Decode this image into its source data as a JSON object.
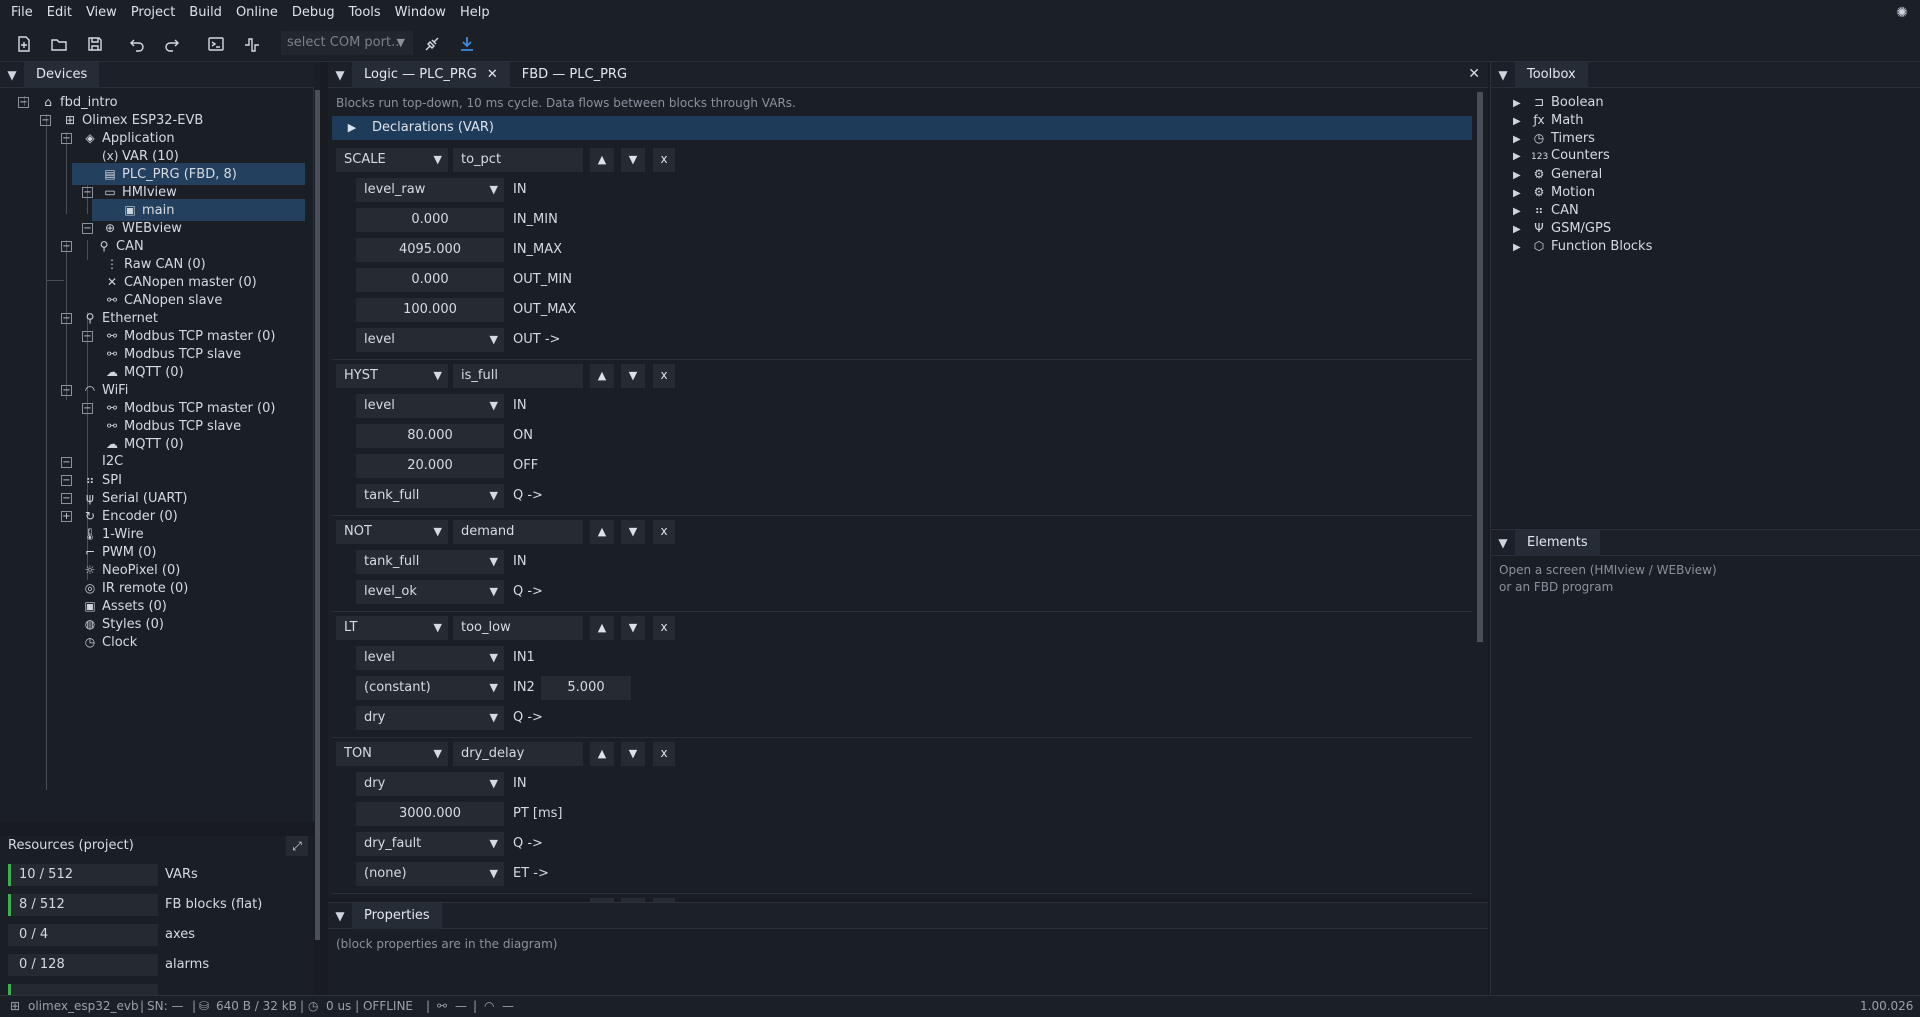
{
  "menu": [
    "File",
    "Edit",
    "View",
    "Project",
    "Build",
    "Online",
    "Debug",
    "Tools",
    "Window",
    "Help"
  ],
  "toolbar": {
    "com_port_placeholder": "select COM port..",
    "icons": [
      "new-file-icon",
      "open-folder-icon",
      "save-icon",
      "undo-icon",
      "redo-icon",
      "terminal-icon",
      "step-icon",
      "connect-icon",
      "download-icon"
    ]
  },
  "devices": {
    "tab": "Devices",
    "tree": [
      {
        "label": "fbd_intro",
        "icon": "project-icon"
      },
      {
        "label": "Olimex ESP32-EVB",
        "icon": "chip-icon"
      },
      {
        "label": "Application",
        "icon": "layers-icon"
      },
      {
        "label": "VAR (10)",
        "icon": "variable-icon"
      },
      {
        "label": "PLC_PRG (FBD, 8)",
        "icon": "file-icon"
      },
      {
        "label": "HMIview",
        "icon": "monitor-icon"
      },
      {
        "label": "main",
        "icon": "image-icon"
      },
      {
        "label": "WEBview",
        "icon": "globe-icon"
      },
      {
        "label": "CAN",
        "icon": "network-icon"
      },
      {
        "label": "Raw CAN (0)",
        "icon": "raw-can-icon"
      },
      {
        "label": "CANopen master (0)",
        "icon": "canopen-icon"
      },
      {
        "label": "CANopen slave",
        "icon": "plug-icon"
      },
      {
        "label": "Ethernet",
        "icon": "network-icon"
      },
      {
        "label": "Modbus TCP master (0)",
        "icon": "plug-icon"
      },
      {
        "label": "Modbus TCP slave",
        "icon": "plug-icon"
      },
      {
        "label": "MQTT (0)",
        "icon": "cloud-icon"
      },
      {
        "label": "WiFi",
        "icon": "wifi-icon"
      },
      {
        "label": "Modbus TCP master (0)",
        "icon": "plug-icon"
      },
      {
        "label": "Modbus TCP slave",
        "icon": "plug-icon"
      },
      {
        "label": "MQTT (0)",
        "icon": "cloud-icon"
      },
      {
        "label": "I2C",
        "icon": "none"
      },
      {
        "label": "SPI",
        "icon": "spi-icon"
      },
      {
        "label": "Serial (UART)",
        "icon": "usb-icon"
      },
      {
        "label": "Encoder (0)",
        "icon": "encoder-icon"
      },
      {
        "label": "1-Wire",
        "icon": "thermometer-icon"
      },
      {
        "label": "PWM (0)",
        "icon": "pwm-icon"
      },
      {
        "label": "NeoPixel (0)",
        "icon": "light-icon"
      },
      {
        "label": "IR remote (0)",
        "icon": "ir-icon"
      },
      {
        "label": "Assets (0)",
        "icon": "image-icon"
      },
      {
        "label": "Styles (0)",
        "icon": "palette-icon"
      },
      {
        "label": "Clock",
        "icon": "clock-icon"
      }
    ]
  },
  "resources": {
    "title": "Resources (project)",
    "rows": [
      {
        "value": "10 / 512",
        "label": "VARs",
        "level": 0.02
      },
      {
        "value": "8 / 512",
        "label": "FB blocks (flat)",
        "level": 0.016
      },
      {
        "value": "0 / 4",
        "label": "axes",
        "level": 0
      },
      {
        "value": "0 / 128",
        "label": "alarms",
        "level": 0
      }
    ]
  },
  "logic": {
    "tabs": [
      "Logic — PLC_PRG",
      "FBD — PLC_PRG"
    ],
    "info": "Blocks run top-down, 10 ms cycle. Data flows between blocks through VARs.",
    "declarations": "Declarations (VAR)",
    "blocks": [
      {
        "type": "SCALE",
        "name": "to_pct",
        "rows": [
          {
            "kind": "sel",
            "value": "level_raw",
            "port": "IN"
          },
          {
            "kind": "num",
            "value": "0.000",
            "port": "IN_MIN"
          },
          {
            "kind": "num",
            "value": "4095.000",
            "port": "IN_MAX"
          },
          {
            "kind": "num",
            "value": "0.000",
            "port": "OUT_MIN"
          },
          {
            "kind": "num",
            "value": "100.000",
            "port": "OUT_MAX"
          },
          {
            "kind": "sel",
            "value": "level",
            "port": "OUT ->"
          }
        ]
      },
      {
        "type": "HYST",
        "name": "is_full",
        "rows": [
          {
            "kind": "sel",
            "value": "level",
            "port": "IN"
          },
          {
            "kind": "num",
            "value": "80.000",
            "port": "ON"
          },
          {
            "kind": "num",
            "value": "20.000",
            "port": "OFF"
          },
          {
            "kind": "sel",
            "value": "tank_full",
            "port": "Q ->"
          }
        ]
      },
      {
        "type": "NOT",
        "name": "demand",
        "rows": [
          {
            "kind": "sel",
            "value": "tank_full",
            "port": "IN"
          },
          {
            "kind": "sel",
            "value": "level_ok",
            "port": "Q ->"
          }
        ]
      },
      {
        "type": "LT",
        "name": "too_low",
        "rows": [
          {
            "kind": "sel",
            "value": "level",
            "port": "IN1"
          },
          {
            "kind": "sel",
            "value": "(constant)",
            "port": "IN2",
            "extra": "5.000"
          },
          {
            "kind": "sel",
            "value": "dry",
            "port": "Q ->"
          }
        ]
      },
      {
        "type": "TON",
        "name": "dry_delay",
        "rows": [
          {
            "kind": "sel",
            "value": "dry",
            "port": "IN"
          },
          {
            "kind": "num",
            "value": "3000.000",
            "port": "PT [ms]"
          },
          {
            "kind": "sel",
            "value": "dry_fault",
            "port": "Q ->"
          },
          {
            "kind": "sel",
            "value": "(none)",
            "port": "ET ->"
          }
        ]
      }
    ],
    "x_label": "x"
  },
  "toolbox": {
    "tab": "Toolbox",
    "items": [
      {
        "label": "Boolean",
        "icon": "boolean-icon"
      },
      {
        "label": "Math",
        "icon": "function-icon"
      },
      {
        "label": "Timers",
        "icon": "clock-icon"
      },
      {
        "label": "Counters",
        "icon": "counter-icon"
      },
      {
        "label": "General",
        "icon": "gear-icon"
      },
      {
        "label": "Motion",
        "icon": "motion-icon"
      },
      {
        "label": "CAN",
        "icon": "can-icon"
      },
      {
        "label": "GSM/GPS",
        "icon": "antenna-icon"
      },
      {
        "label": "Function Blocks",
        "icon": "cube-icon"
      }
    ]
  },
  "elements": {
    "tab": "Elements",
    "hint_line1": "Open a screen (HMIview / WEBview)",
    "hint_line2": "or an FBD program"
  },
  "properties": {
    "tab": "Properties",
    "hint": "(block properties are in the diagram)"
  },
  "status": {
    "device": "olimex_esp32_evb",
    "sn": "SN: —",
    "memory": "640 B / 32 kB",
    "cycle": "0 us | OFFLINE",
    "link": "—",
    "wifi": "—",
    "version": "1.00.026"
  },
  "colors": {
    "accent": "#1f3b5a",
    "selection": "#23405f",
    "resource_bar": "#3fae4e"
  }
}
